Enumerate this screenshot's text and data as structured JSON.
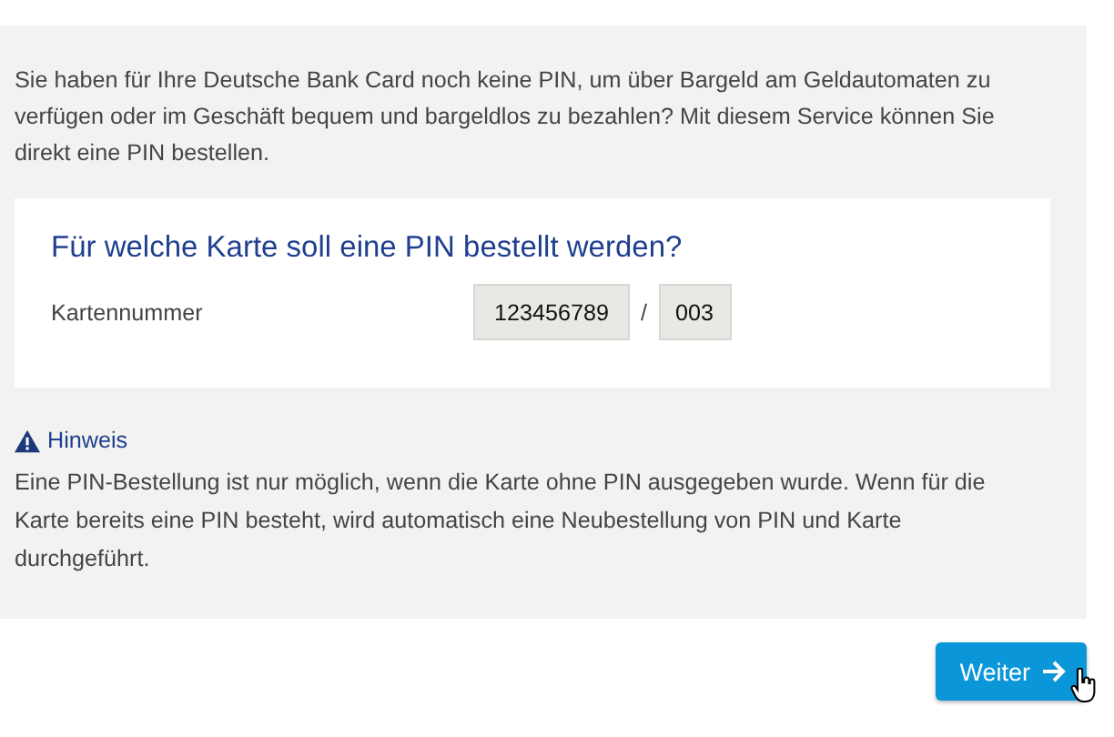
{
  "intro": "Sie haben für Ihre Deutsche Bank Card noch keine PIN, um über Bargeld am Geldautomaten zu verfügen oder im Geschäft bequem und bargeldlos zu bezahlen? Mit diesem Service können Sie direkt eine PIN bestellen.",
  "card_form": {
    "heading": "Für welche Karte soll eine PIN bestellt werden?",
    "label": "Kartennummer",
    "number": "123456789",
    "separator": "/",
    "suffix": "003"
  },
  "notice": {
    "title": "Hinweis",
    "text": "Eine PIN-Bestellung ist nur möglich, wenn die Karte ohne PIN ausgegeben wurde. Wenn für die Karte bereits eine PIN besteht, wird automatisch eine Neubestellung von PIN und Karte durchgeführt."
  },
  "buttons": [
    {
      "label": "Weiter",
      "kind": "next"
    }
  ]
}
